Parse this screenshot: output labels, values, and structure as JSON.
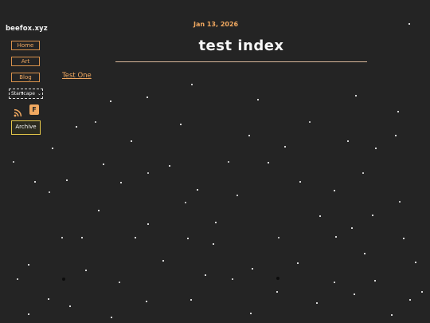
{
  "site": {
    "title": "beefox.xyz"
  },
  "nav": {
    "home_label": "Home",
    "art_label": "Art",
    "blog_label": "Blog"
  },
  "theme_select": {
    "value": "Starscape",
    "icon": "chevron-down-icon"
  },
  "social": {
    "rss_icon": "rss-icon",
    "f_label": "F"
  },
  "archive": {
    "label": "Archive"
  },
  "main": {
    "date": "Jan 13, 2026",
    "title": "test index",
    "posts": [
      {
        "title": "Test One"
      }
    ]
  },
  "colors": {
    "background": "#242424",
    "accent": "#f0a860",
    "archive_border": "#e6c84a",
    "rule": "#d9b89a"
  }
}
